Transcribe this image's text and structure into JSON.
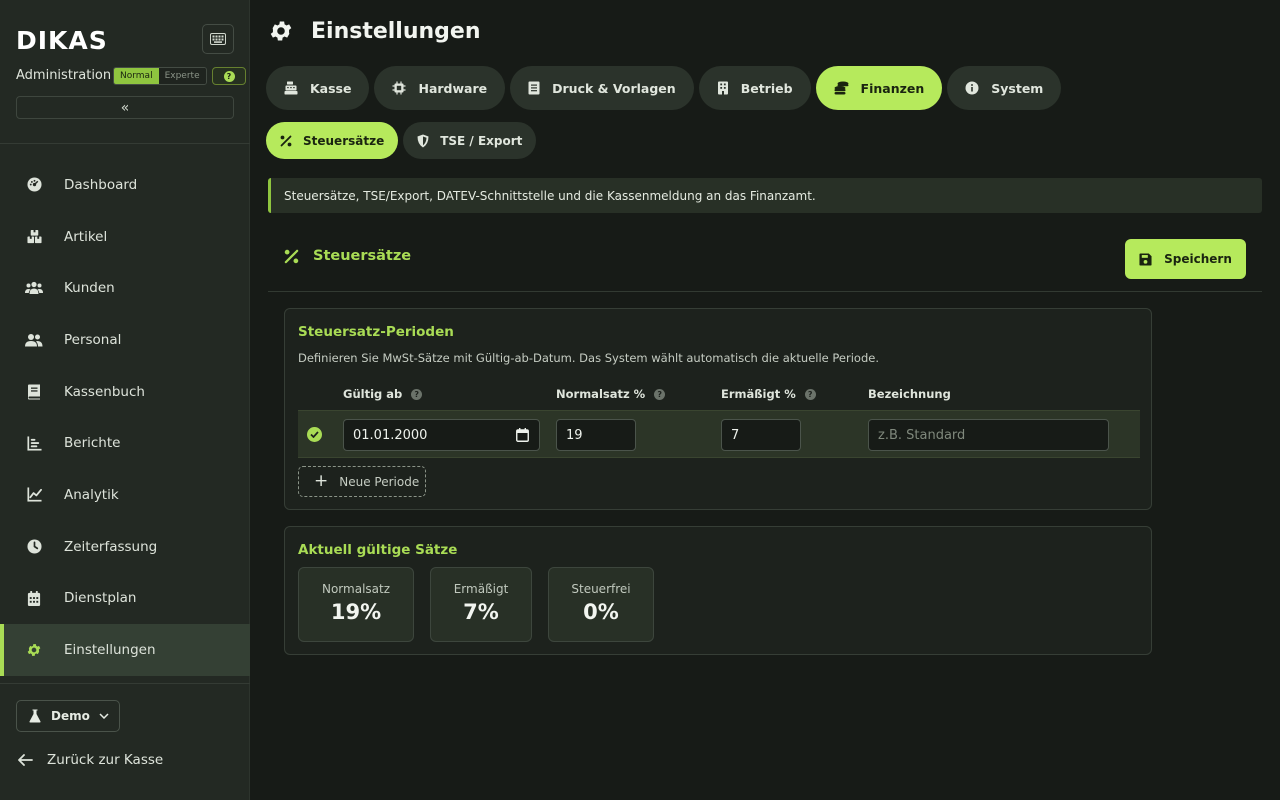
{
  "sidebar": {
    "logo": "DIKAS",
    "admin_label": "Administration",
    "mode_normal": "Normal",
    "mode_expert": "Experte",
    "help": "?",
    "collapse": "«",
    "items": [
      {
        "label": "Dashboard",
        "icon": "dashboard-icon"
      },
      {
        "label": "Artikel",
        "icon": "boxes-icon"
      },
      {
        "label": "Kunden",
        "icon": "users-icon"
      },
      {
        "label": "Personal",
        "icon": "staff-icon"
      },
      {
        "label": "Kassenbuch",
        "icon": "book-icon"
      },
      {
        "label": "Berichte",
        "icon": "report-icon"
      },
      {
        "label": "Analytik",
        "icon": "chart-line-icon"
      },
      {
        "label": "Zeiterfassung",
        "icon": "clock-icon"
      },
      {
        "label": "Dienstplan",
        "icon": "calendar-icon"
      },
      {
        "label": "Einstellungen",
        "icon": "gear-icon",
        "active": true
      }
    ],
    "demo_label": "Demo",
    "back_label": "Zurück zur Kasse"
  },
  "header": {
    "title": "Einstellungen"
  },
  "tabs": [
    {
      "label": "Kasse",
      "icon": "register-icon"
    },
    {
      "label": "Hardware",
      "icon": "chip-icon"
    },
    {
      "label": "Druck & Vorlagen",
      "icon": "document-icon"
    },
    {
      "label": "Betrieb",
      "icon": "building-icon"
    },
    {
      "label": "Finanzen",
      "icon": "coins-icon",
      "active": true
    },
    {
      "label": "System",
      "icon": "info-icon"
    }
  ],
  "subtabs": [
    {
      "label": "Steuersätze",
      "icon": "percent-icon",
      "active": true
    },
    {
      "label": "TSE / Export",
      "icon": "shield-icon"
    }
  ],
  "banner": {
    "text": "Steuersätze, TSE/Export, DATEV-Schnittstelle und die Kassenmeldung an das Finanzamt."
  },
  "section": {
    "title": "Steuersätze",
    "save_label": "Speichern"
  },
  "periods_card": {
    "title": "Steuersatz-Perioden",
    "description": "Definieren Sie MwSt-Sätze mit Gültig-ab-Datum. Das System wählt automatisch die aktuelle Periode.",
    "columns": {
      "valid_from": "Gültig ab",
      "normal": "Normalsatz %",
      "reduced": "Ermäßigt %",
      "name": "Bezeichnung"
    },
    "rows": [
      {
        "valid_from": "01.01.2000",
        "normal": "19",
        "reduced": "7",
        "name": "",
        "name_placeholder": "z.B. Standard"
      }
    ],
    "new_period_label": "Neue Periode"
  },
  "current_card": {
    "title": "Aktuell gültige Sätze",
    "rates": [
      {
        "label": "Normalsatz",
        "value": "19%"
      },
      {
        "label": "Ermäßigt",
        "value": "7%"
      },
      {
        "label": "Steuerfrei",
        "value": "0%"
      }
    ]
  },
  "colors": {
    "accent": "#b6ea5c",
    "accent_text": "#a9dc55",
    "background": "#171b17",
    "sidebar": "#232923"
  }
}
